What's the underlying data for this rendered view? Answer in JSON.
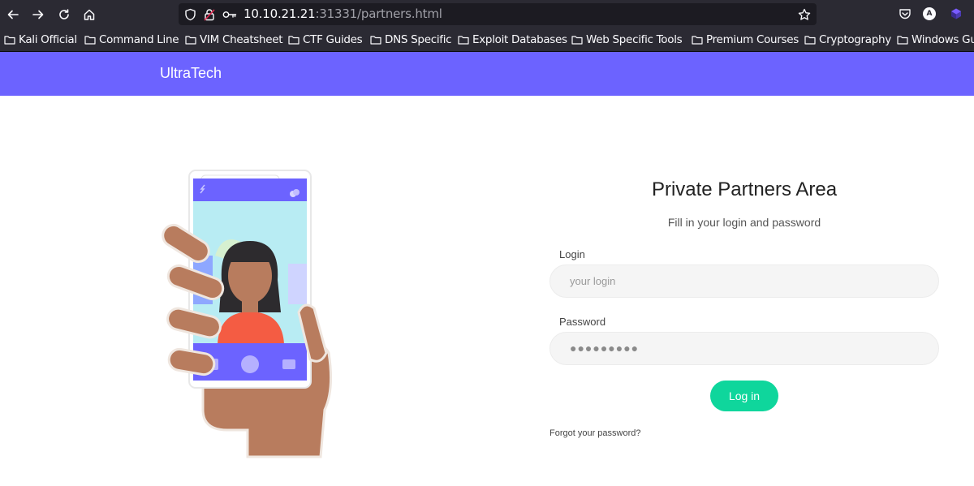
{
  "browser": {
    "url_host": "10.10.21.21",
    "url_rest": ":31331/partners.html",
    "profile_letter": "A"
  },
  "bookmarks": [
    "Kali Official",
    "Command Line",
    "VIM Cheatsheet",
    "CTF Guides",
    "DNS Specific",
    "Exploit Databases",
    "Web Specific Tools",
    "Premium Courses",
    "Cryptography",
    "Windows Gu"
  ],
  "site": {
    "brand": "UltraTech"
  },
  "login": {
    "title": "Private Partners Area",
    "subtitle": "Fill in your login and password",
    "login_label": "Login",
    "login_placeholder": "your login",
    "password_label": "Password",
    "password_value": "●●●●●●●●●",
    "button": "Log in",
    "forgot": "Forgot your password?"
  },
  "colors": {
    "navbar": "#6c63ff",
    "button": "#0fd69c"
  }
}
